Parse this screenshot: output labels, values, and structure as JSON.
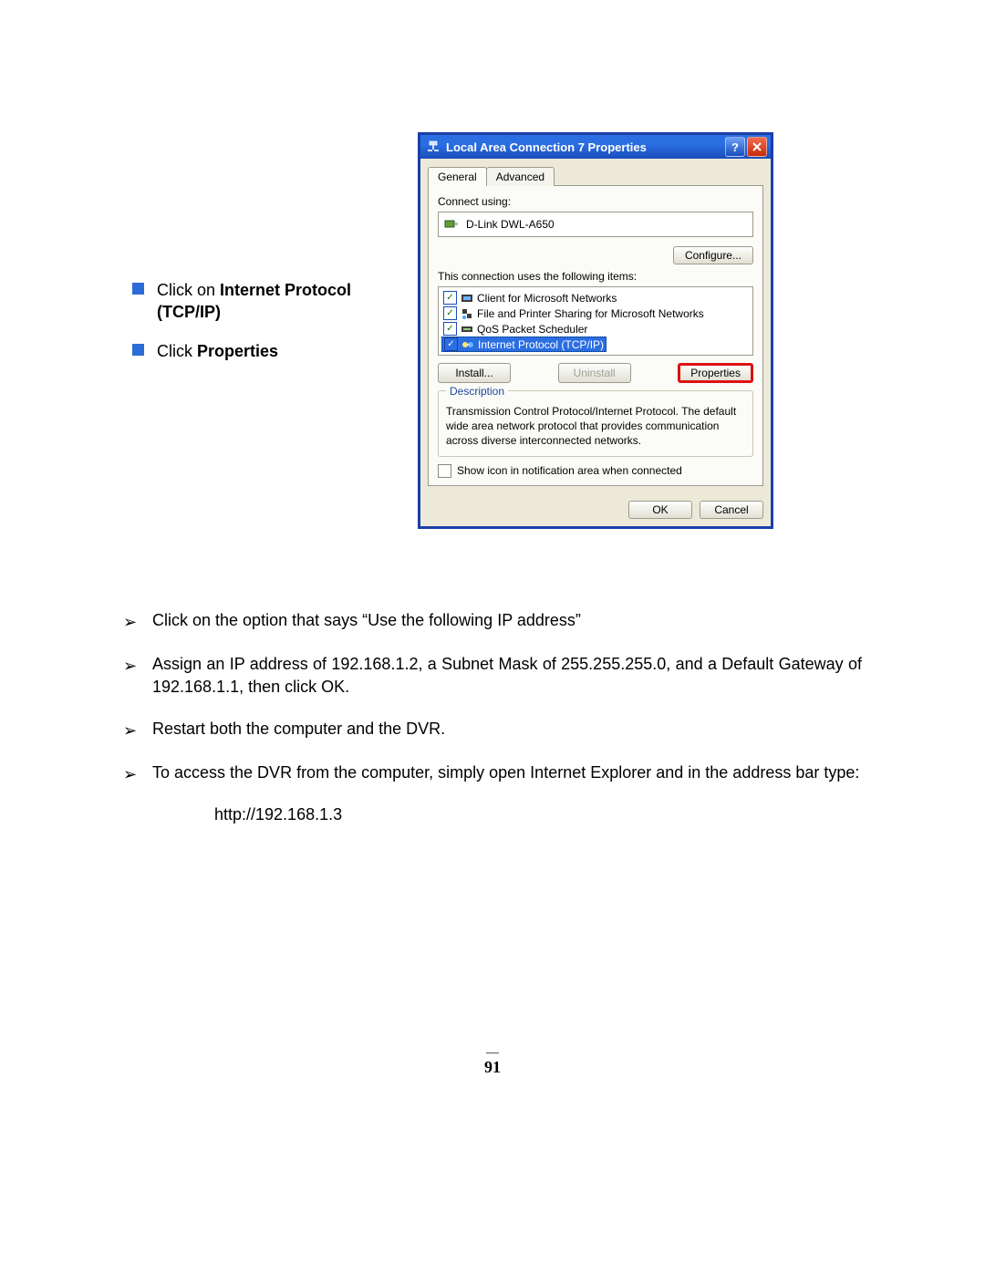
{
  "leftInstructions": {
    "item1_prefix": "Click on ",
    "item1_bold": "Internet Protocol (TCP/IP)",
    "item2_prefix": "Click ",
    "item2_bold": "Properties"
  },
  "dialog": {
    "title": "Local Area Connection 7 Properties",
    "tabs": {
      "general": "General",
      "advanced": "Advanced"
    },
    "connectUsingLabel": "Connect using:",
    "nicName": "D-Link DWL-A650",
    "configureBtn": "Configure...",
    "itemsLabel": "This connection uses the following items:",
    "items": {
      "i0": "Client for Microsoft Networks",
      "i1": "File and Printer Sharing for Microsoft Networks",
      "i2": "QoS Packet Scheduler",
      "i3": "Internet Protocol (TCP/IP)"
    },
    "installBtn": "Install...",
    "uninstallBtn": "Uninstall",
    "propertiesBtn": "Properties",
    "descriptionLegend": "Description",
    "descriptionText": "Transmission Control Protocol/Internet Protocol. The default wide area network protocol that provides communication across diverse interconnected networks.",
    "showIconLabel": "Show icon in notification area when connected",
    "okBtn": "OK",
    "cancelBtn": "Cancel"
  },
  "steps": {
    "s1": "Click on the option that says “Use the following IP address”",
    "s2": "Assign an IP address of 192.168.1.2, a Subnet Mask of 255.255.255.0, and a Default Gateway of 192.168.1.1, then click OK.",
    "s3": "Restart both the computer and the DVR.",
    "s4": "To access the DVR from the computer, simply open Internet Explorer and in the address bar type:",
    "url": "http://192.168.1.3"
  },
  "pageNumber": "91"
}
